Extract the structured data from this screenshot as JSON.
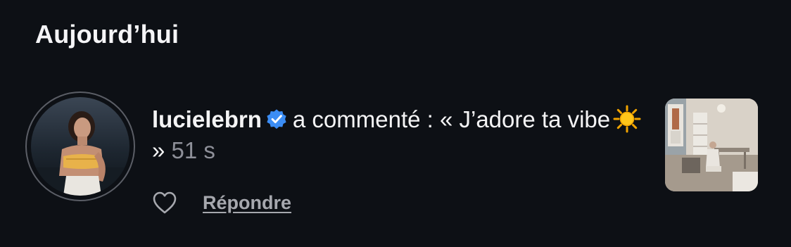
{
  "section": {
    "title": "Aujourd’hui"
  },
  "notification": {
    "username": "lucielebrn",
    "verified_icon": "verified-badge-icon",
    "verified_color": "#3b8df5",
    "action_text": "a commenté : « J’adore ta vibe",
    "emoji_icon": "sun-emoji-icon",
    "closing_quote": "»",
    "time": "51 s",
    "like_icon": "heart-outline-icon",
    "reply_label": "Répondre"
  },
  "colors": {
    "background": "#0d1015",
    "text": "#f4f4f5",
    "muted": "#8e9099",
    "reply": "#a6a8ae"
  }
}
